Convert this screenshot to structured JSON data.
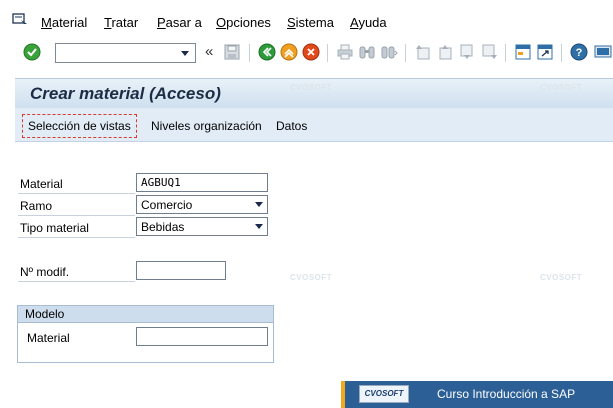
{
  "menu": {
    "items": [
      {
        "label": "Material",
        "underline": "M",
        "rest": "aterial"
      },
      {
        "label": "Tratar",
        "underline": "T",
        "rest": "ratar"
      },
      {
        "label": "Pasar a",
        "underline": "P",
        "rest": "asar a"
      },
      {
        "label": "Opciones",
        "underline": "O",
        "rest": "pciones"
      },
      {
        "label": "Sistema",
        "underline": "S",
        "rest": "istema"
      },
      {
        "label": "Ayuda",
        "underline": "A",
        "rest": "yuda"
      }
    ]
  },
  "toolbar": {
    "command_value": "",
    "history_symbol": "«"
  },
  "title": "Crear material (Acceso)",
  "app_toolbar": {
    "buttons": [
      "Selección de vistas",
      "Niveles organización",
      "Datos"
    ]
  },
  "form": {
    "material_label": "Material",
    "material_value": "AGBUQ1",
    "ramo_label": "Ramo",
    "ramo_value": "Comercio",
    "tipo_label": "Tipo material",
    "tipo_value": "Bebidas",
    "modif_label": "Nº modif.",
    "modif_value": ""
  },
  "modelo": {
    "title": "Modelo",
    "material_label": "Material",
    "material_value": ""
  },
  "watermark": "CVOSOFT",
  "banner": {
    "logo": "CVOSOFT",
    "text": "Curso Introducción a SAP"
  },
  "colors": {
    "title_bg": "#cfe0ef",
    "app_toolbar_bg": "#e2ecf6",
    "banner_bg": "#2b5f95",
    "banner_accent": "#f2a81a",
    "ok_green": "#3aa23a",
    "back_green": "#2e9b3a",
    "exit_orange": "#f0a020",
    "cancel_red": "#e04a1a"
  }
}
